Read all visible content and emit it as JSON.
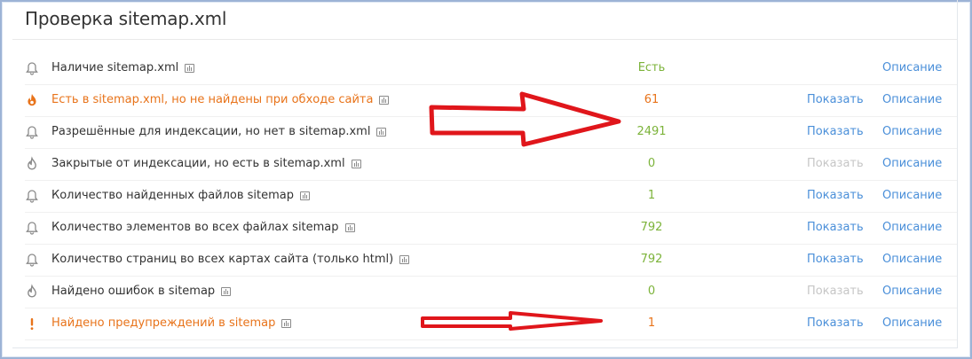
{
  "title": "Проверка sitemap.xml",
  "colors": {
    "ok_value": "#7cb33a",
    "warning": "#e8731a",
    "link": "#4a8fd9",
    "link_disabled": "#c6c6c6",
    "annotation_arrow": "#e0161b"
  },
  "rows": [
    {
      "icon": "bell-icon",
      "label": "Наличие sitemap.xml",
      "status": "normal",
      "value": "Есть",
      "value_color": "green",
      "show": "",
      "show_enabled": false,
      "desc": "Описание"
    },
    {
      "icon": "flame-icon",
      "label": "Есть в sitemap.xml, но не найдены при обходе сайта",
      "status": "error",
      "value": "61",
      "value_color": "orange",
      "show": "Показать",
      "show_enabled": true,
      "desc": "Описание"
    },
    {
      "icon": "bell-icon",
      "label": "Разрешённые для индексации, но нет в sitemap.xml",
      "status": "normal",
      "value": "2491",
      "value_color": "green",
      "show": "Показать",
      "show_enabled": true,
      "desc": "Описание"
    },
    {
      "icon": "flame-outline-icon",
      "label": "Закрытые от индексации, но есть в sitemap.xml",
      "status": "normal",
      "value": "0",
      "value_color": "green",
      "show": "Показать",
      "show_enabled": false,
      "desc": "Описание"
    },
    {
      "icon": "bell-icon",
      "label": "Количество найденных файлов sitemap",
      "status": "normal",
      "value": "1",
      "value_color": "green",
      "show": "Показать",
      "show_enabled": true,
      "desc": "Описание"
    },
    {
      "icon": "bell-icon",
      "label": "Количество элементов во всех файлах sitemap",
      "status": "normal",
      "value": "792",
      "value_color": "green",
      "show": "Показать",
      "show_enabled": true,
      "desc": "Описание"
    },
    {
      "icon": "bell-icon",
      "label": "Количество страниц во всех картах сайта (только html)",
      "status": "normal",
      "value": "792",
      "value_color": "green",
      "show": "Показать",
      "show_enabled": true,
      "desc": "Описание"
    },
    {
      "icon": "flame-outline-icon",
      "label": "Найдено ошибок в sitemap",
      "status": "normal",
      "value": "0",
      "value_color": "green",
      "show": "Показать",
      "show_enabled": false,
      "desc": "Описание"
    },
    {
      "icon": "exclamation-icon",
      "label": "Найдено предупреждений в sitemap",
      "status": "warning",
      "value": "1",
      "value_color": "orange",
      "show": "Показать",
      "show_enabled": true,
      "desc": "Описание"
    }
  ]
}
